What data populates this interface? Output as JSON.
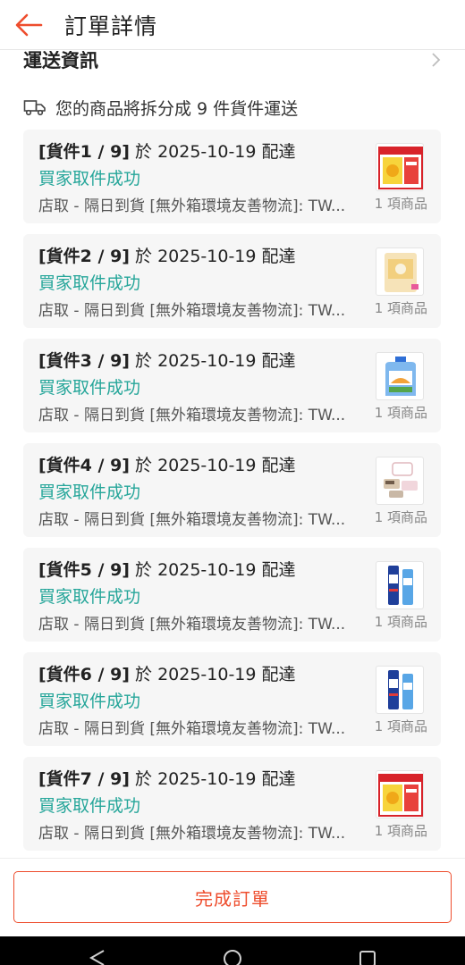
{
  "header": {
    "title": "訂單詳情",
    "back_icon": "arrow-left-icon"
  },
  "delivery_section": {
    "title": "運送資訊",
    "split_notice": "您的商品將拆分成 9 件貨件運送"
  },
  "colors": {
    "accent": "#ee4d2d",
    "status_green": "#26a69a"
  },
  "shipments": [
    {
      "tag": "[貨件1 / 9]",
      "date_text": " 於 2025-10-19 配達",
      "status": "買家取件成功",
      "method": "店取 - 隔日到貨 [無外箱環境友善物流]: TW...",
      "count": "1 項商品",
      "thumb": "supplement-box"
    },
    {
      "tag": "[貨件2 / 9]",
      "date_text": " 於 2025-10-19 配達",
      "status": "買家取件成功",
      "method": "店取 - 隔日到貨 [無外箱環境友善物流]: TW...",
      "count": "1 項商品",
      "thumb": "mask-pack"
    },
    {
      "tag": "[貨件3 / 9]",
      "date_text": " 於 2025-10-19 配達",
      "status": "買家取件成功",
      "method": "店取 - 隔日到貨 [無外箱環境友善物流]: TW...",
      "count": "1 項商品",
      "thumb": "detergent-bottle"
    },
    {
      "tag": "[貨件4 / 9]",
      "date_text": " 於 2025-10-19 配達",
      "status": "買家取件成功",
      "method": "店取 - 隔日到貨 [無外箱環境友善物流]: TW...",
      "count": "1 項商品",
      "thumb": "accessory-set"
    },
    {
      "tag": "[貨件5 / 9]",
      "date_text": " 於 2025-10-19 配達",
      "status": "買家取件成功",
      "method": "店取 - 隔日到貨 [無外箱環境友善物流]: TW...",
      "count": "1 項商品",
      "thumb": "toothpaste"
    },
    {
      "tag": "[貨件6 / 9]",
      "date_text": " 於 2025-10-19 配達",
      "status": "買家取件成功",
      "method": "店取 - 隔日到貨 [無外箱環境友善物流]: TW...",
      "count": "1 項商品",
      "thumb": "toothpaste"
    },
    {
      "tag": "[貨件7 / 9]",
      "date_text": " 於 2025-10-19 配達",
      "status": "買家取件成功",
      "method": "店取 - 隔日到貨 [無外箱環境友善物流]: TW...",
      "count": "1 項商品",
      "thumb": "supplement-box"
    }
  ],
  "footer": {
    "complete_label": "完成訂單"
  },
  "system_nav": {
    "back_icon": "nav-back-icon",
    "home_icon": "nav-home-icon",
    "recents_icon": "nav-recents-icon"
  }
}
